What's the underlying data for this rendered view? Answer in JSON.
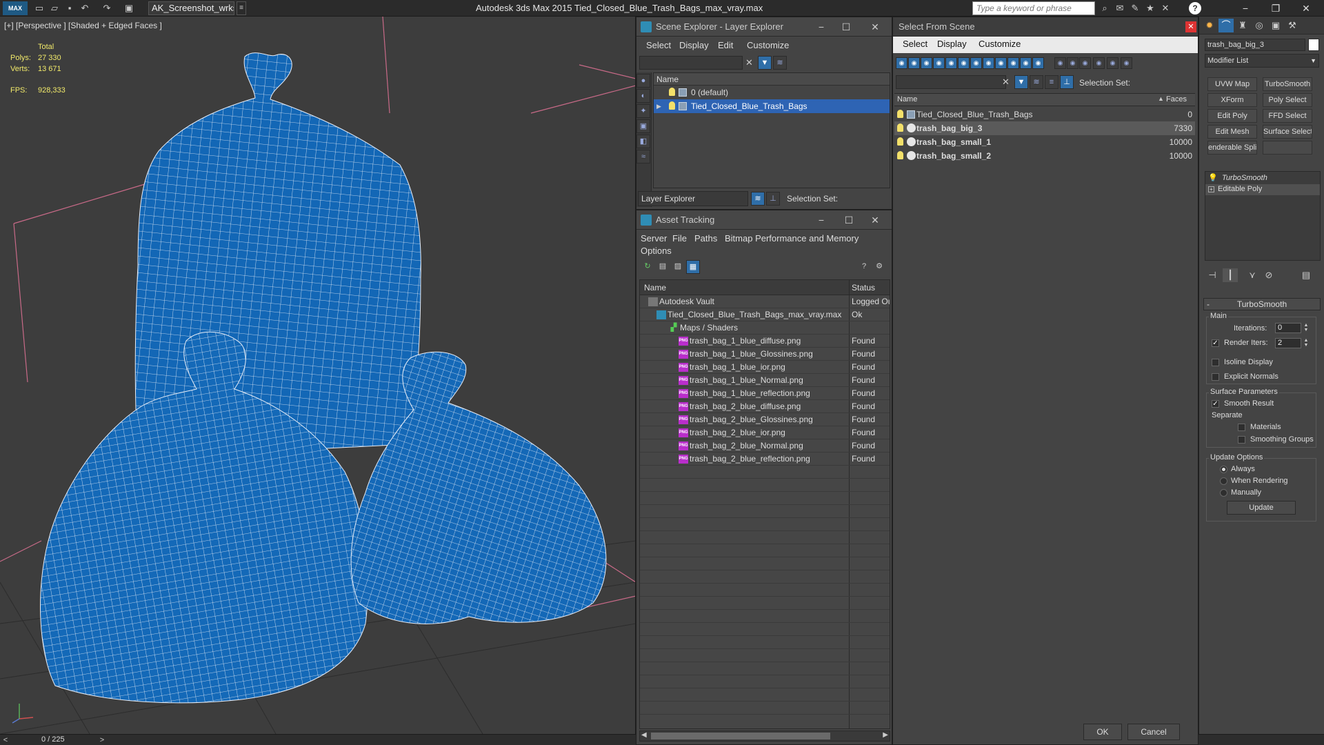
{
  "titlebar": {
    "logo": "MAX",
    "workspace": "AK_Screenshot_wrksp",
    "app_title": "Autodesk 3ds Max  2015      Tied_Closed_Blue_Trash_Bags_max_vray.max",
    "search_placeholder": "Type a keyword or phrase"
  },
  "viewport": {
    "label": "[+] [Perspective ] [Shaded + Edged Faces ]",
    "stats": {
      "total_label": "Total",
      "polys_label": "Polys:",
      "polys_value": "27 330",
      "verts_label": "Verts:",
      "verts_value": "13 671",
      "fps_label": "FPS:",
      "fps_value": "928,333"
    }
  },
  "statusbar": {
    "frame": "0 / 225",
    "prev": "<",
    "next": ">"
  },
  "scene_explorer": {
    "title": "Scene Explorer - Layer Explorer",
    "menu": [
      "Select",
      "Display",
      "Edit",
      "Customize"
    ],
    "column_name": "Name",
    "rows": [
      {
        "label": "0 (default)"
      },
      {
        "label": "Tied_Closed_Blue_Trash_Bags"
      }
    ],
    "bottom_dropdown": "Layer Explorer",
    "selection_set_label": "Selection Set:"
  },
  "asset_tracking": {
    "title": "Asset Tracking",
    "menu": [
      "Server",
      "File",
      "Paths",
      "Bitmap Performance and Memory",
      "Options"
    ],
    "col_name": "Name",
    "col_status": "Status",
    "rows": [
      {
        "name": "Autodesk Vault",
        "status": "Logged Ou",
        "indent": 1,
        "icon": "vault"
      },
      {
        "name": "Tied_Closed_Blue_Trash_Bags_max_vray.max",
        "status": "Ok",
        "indent": 2,
        "icon": "max"
      },
      {
        "name": "Maps / Shaders",
        "status": "",
        "indent": 3,
        "icon": "maps"
      },
      {
        "name": "trash_bag_1_blue_diffuse.png",
        "status": "Found",
        "indent": 4,
        "icon": "png"
      },
      {
        "name": "trash_bag_1_blue_Glossines.png",
        "status": "Found",
        "indent": 4,
        "icon": "png"
      },
      {
        "name": "trash_bag_1_blue_ior.png",
        "status": "Found",
        "indent": 4,
        "icon": "png"
      },
      {
        "name": "trash_bag_1_blue_Normal.png",
        "status": "Found",
        "indent": 4,
        "icon": "png"
      },
      {
        "name": "trash_bag_1_blue_reflection.png",
        "status": "Found",
        "indent": 4,
        "icon": "png"
      },
      {
        "name": "trash_bag_2_blue_diffuse.png",
        "status": "Found",
        "indent": 4,
        "icon": "png"
      },
      {
        "name": "trash_bag_2_blue_Glossines.png",
        "status": "Found",
        "indent": 4,
        "icon": "png"
      },
      {
        "name": "trash_bag_2_blue_ior.png",
        "status": "Found",
        "indent": 4,
        "icon": "png"
      },
      {
        "name": "trash_bag_2_blue_Normal.png",
        "status": "Found",
        "indent": 4,
        "icon": "png"
      },
      {
        "name": "trash_bag_2_blue_reflection.png",
        "status": "Found",
        "indent": 4,
        "icon": "png"
      }
    ]
  },
  "select_from_scene": {
    "title": "Select From Scene",
    "menu": [
      "Select",
      "Display",
      "Customize"
    ],
    "selection_set_label": "Selection Set:",
    "col_name": "Name",
    "col_faces": "Faces",
    "rows": [
      {
        "name": "Tied_Closed_Blue_Trash_Bags",
        "faces": "0"
      },
      {
        "name": "trash_bag_big_3",
        "faces": "7330"
      },
      {
        "name": "trash_bag_small_1",
        "faces": "10000"
      },
      {
        "name": "trash_bag_small_2",
        "faces": "10000"
      }
    ],
    "ok": "OK",
    "cancel": "Cancel"
  },
  "command_panel": {
    "object_name": "trash_bag_big_3",
    "modifier_list": "Modifier List",
    "modifier_buttons": [
      "UVW Map",
      "TurboSmooth",
      "XForm",
      "Poly Select",
      "Edit Poly",
      "FFD Select",
      "Edit Mesh",
      "Surface Select",
      "enderable Splin",
      ""
    ],
    "stack": [
      "TurboSmooth",
      "Editable Poly"
    ],
    "turbosmooth": {
      "title": "TurboSmooth",
      "main_label": "Main",
      "iterations_label": "Iterations:",
      "iterations_value": "0",
      "render_iters_label": "Render Iters:",
      "render_iters_value": "2",
      "isoline_label": "Isoline Display",
      "explicit_normals_label": "Explicit Normals",
      "surface_params_label": "Surface Parameters",
      "smooth_result_label": "Smooth Result",
      "separate_label": "Separate",
      "materials_label": "Materials",
      "smoothing_groups_label": "Smoothing Groups",
      "update_options_label": "Update Options",
      "always_label": "Always",
      "when_rendering_label": "When Rendering",
      "manually_label": "Manually",
      "update_button": "Update"
    }
  }
}
